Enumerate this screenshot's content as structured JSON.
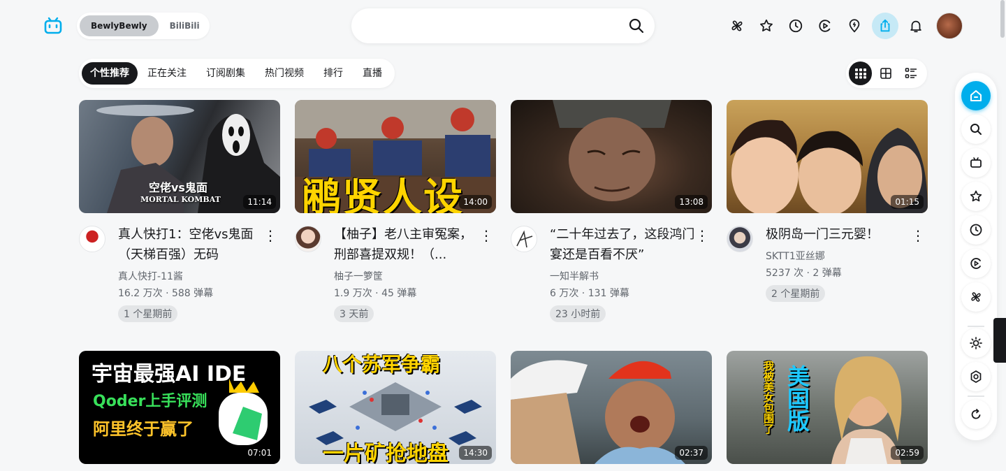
{
  "header": {
    "switcher": [
      "BewlyBewly",
      "BiliBili"
    ],
    "search_placeholder": ""
  },
  "tabs": [
    "个性推荐",
    "正在关注",
    "订阅剧集",
    "热门视频",
    "排行",
    "直播"
  ],
  "videos": [
    {
      "title": "真人快打1：空佬vs鬼面（天梯百强）无码",
      "author": "真人快打-11酱",
      "stats": "16.2 万次 · 588 弹幕",
      "time": "1 个星期前",
      "duration": "11:14",
      "overlay": "空佬vs鬼面",
      "overlay2": "MORTAL KOMBAT"
    },
    {
      "title": "【柚子】老八主审冤案，刑部喜提双规！（...",
      "author": "柚子一箩筐",
      "stats": "1.9 万次 · 45 弹幕",
      "time": "3 天前",
      "duration": "14:00",
      "overlay": "鹇贤人设"
    },
    {
      "title": "“二十年过去了，这段鸿门宴还是百看不厌”",
      "author": "一知半解书",
      "stats": "6 万次 · 131 弹幕",
      "time": "23 小时前",
      "duration": "13:08"
    },
    {
      "title": "极阴岛一门三元婴！",
      "author": "SKTT1亚丝娜",
      "stats": "5237 次 · 2 弹幕",
      "time": "2 个星期前",
      "duration": "01:15"
    },
    {
      "duration": "07:01",
      "overlay": "宇宙最强AI IDE",
      "overlay2": "Qoder上手评测",
      "overlay3": "阿里终于赢了"
    },
    {
      "duration": "14:30",
      "overlay": "八个苏军争霸",
      "overlay2": "一片矿抢地盘"
    },
    {
      "duration": "02:37"
    },
    {
      "duration": "02:59",
      "overlay": "美国版",
      "overlay2": "我被美女包围了"
    }
  ],
  "icons": {
    "logo": "bilibili-tv-icon",
    "topbar": [
      "pinwheel-icon",
      "star-icon",
      "clock-icon",
      "play-circle-icon",
      "pin-icon",
      "upload-icon",
      "bell-icon"
    ],
    "dock": [
      "home-icon",
      "search-icon",
      "tv-icon",
      "star-icon",
      "clock-icon",
      "play-circle-icon",
      "pinwheel-icon",
      "sun-icon",
      "settings-icon",
      "refresh-icon"
    ]
  },
  "colors": {
    "accent": "#00aeec",
    "text": "#18191c",
    "muted": "#61666d"
  }
}
